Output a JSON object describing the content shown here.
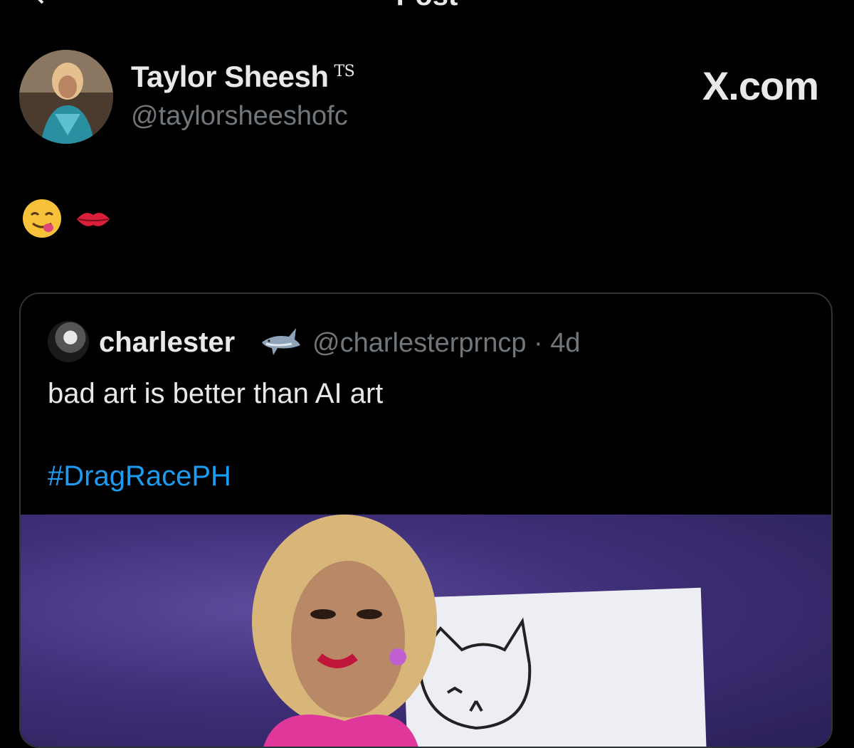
{
  "header": {
    "title": "Post"
  },
  "author": {
    "name": "Taylor Sheesh",
    "badge": "TS",
    "handle": "@taylorsheeshofc"
  },
  "watermark": "X.com",
  "post": {
    "emojis": [
      "yum-face-emoji",
      "kiss-mark-emoji"
    ]
  },
  "quote": {
    "name": "charlester",
    "handle_time": "@charlesterprncp · 4d",
    "text": "bad art is better than AI art",
    "hashtag": "#DragRacePH"
  },
  "colors": {
    "background": "#000000",
    "text": "#e7e9ea",
    "muted": "#71767b",
    "link": "#1d9bf0",
    "border": "#2f3336"
  }
}
